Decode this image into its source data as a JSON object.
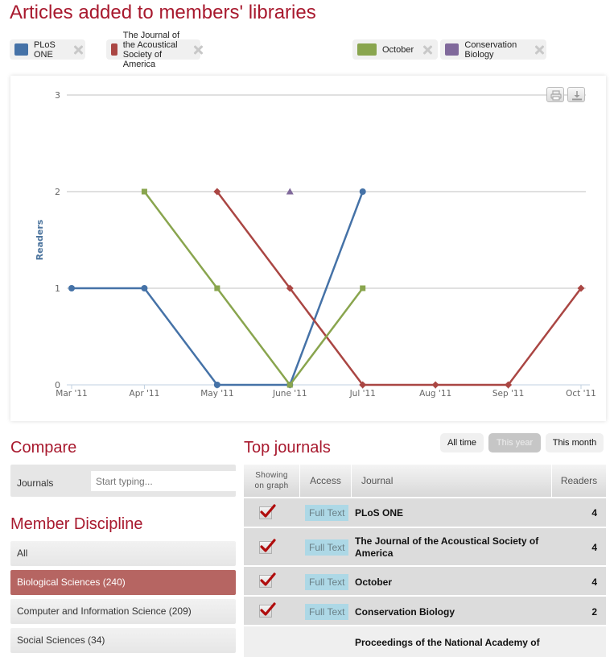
{
  "page_title": "Articles added to members' libraries",
  "legend_tags": [
    {
      "label": "PLoS ONE",
      "color": "#4572a7"
    },
    {
      "label": "The Journal of the Acoustical Society of America",
      "color": "#aa4643"
    },
    {
      "label": "October",
      "color": "#89a54e"
    },
    {
      "label": "Conservation Biology",
      "color": "#80699b"
    }
  ],
  "chart_toolbar": {
    "print_icon": "print-icon",
    "download_icon": "download-icon"
  },
  "chart_data": {
    "type": "line",
    "title": "",
    "xlabel": "",
    "ylabel": "Readers",
    "categories": [
      "Mar '11",
      "Apr '11",
      "May '11",
      "June '11",
      "Jul '11",
      "Aug '11",
      "Sep '11",
      "Oct '11"
    ],
    "y_ticks": [
      "0",
      "1",
      "2",
      "3"
    ],
    "ylim": [
      0,
      3
    ],
    "grid": true,
    "legend": "top",
    "series": [
      {
        "name": "PLoS ONE",
        "color": "#4572a7",
        "marker": "circle",
        "values": [
          1,
          1,
          0,
          0,
          2,
          null,
          null,
          null
        ]
      },
      {
        "name": "The Journal of the Acoustical Society of America",
        "color": "#aa4643",
        "marker": "diamond",
        "values": [
          null,
          null,
          2,
          1,
          0,
          0,
          0,
          1
        ]
      },
      {
        "name": "October",
        "color": "#89a54e",
        "marker": "square",
        "values": [
          null,
          2,
          1,
          0,
          1,
          null,
          null,
          null
        ]
      },
      {
        "name": "Conservation Biology",
        "color": "#80699b",
        "marker": "triangle",
        "values": [
          null,
          null,
          null,
          2,
          null,
          null,
          null,
          null
        ]
      }
    ]
  },
  "compare": {
    "title": "Compare",
    "journals_label": "Journals",
    "journals_placeholder": "Start typing..."
  },
  "discipline": {
    "title": "Member Discipline",
    "items": [
      {
        "label": "All",
        "active": false
      },
      {
        "label": "Biological Sciences (240)",
        "active": true
      },
      {
        "label": "Computer and Information Science (209)",
        "active": false
      },
      {
        "label": "Social Sciences (34)",
        "active": false
      }
    ]
  },
  "top_journals": {
    "title": "Top journals",
    "ranges": [
      {
        "label": "All time",
        "active": false
      },
      {
        "label": "This year",
        "active": true
      },
      {
        "label": "This month",
        "active": false
      }
    ],
    "headers": {
      "showing_line1": "Showing",
      "showing_line2": "on graph",
      "access": "Access",
      "journal": "Journal",
      "readers": "Readers"
    },
    "rows": [
      {
        "checked": true,
        "access": "Full Text",
        "journal": "PLoS ONE",
        "readers": "4"
      },
      {
        "checked": true,
        "access": "Full Text",
        "journal": "The Journal of the Acoustical Society of America",
        "readers": "4"
      },
      {
        "checked": true,
        "access": "Full Text",
        "journal": "October",
        "readers": "4"
      },
      {
        "checked": true,
        "access": "Full Text",
        "journal": "Conservation Biology",
        "readers": "2"
      },
      {
        "checked": false,
        "access": "",
        "journal": "Proceedings of the National Academy of",
        "readers": ""
      }
    ]
  }
}
